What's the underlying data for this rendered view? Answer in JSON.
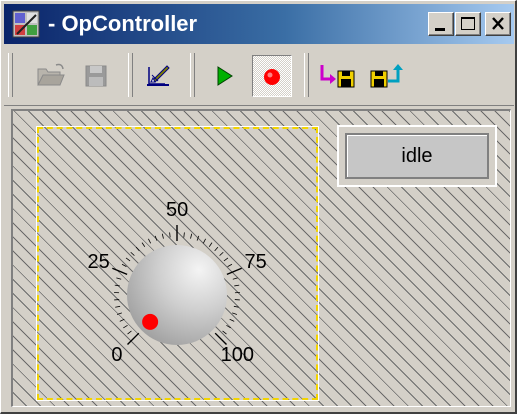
{
  "window": {
    "title": "- OpController"
  },
  "caption_buttons": [
    "minimize-icon",
    "maximize-icon",
    "close-icon"
  ],
  "toolbar": {
    "buttons": [
      {
        "name": "open",
        "icon": "folder-open-icon",
        "enabled": false
      },
      {
        "name": "save",
        "icon": "floppy-save-icon",
        "enabled": false
      },
      {
        "name": "edit",
        "icon": "edit-pencil-icon",
        "enabled": true
      },
      {
        "name": "run",
        "icon": "play-icon",
        "enabled": true,
        "color": "#00b000"
      },
      {
        "name": "record",
        "icon": "record-icon",
        "enabled": true,
        "pressed": true,
        "color": "#ff0000"
      },
      {
        "name": "import",
        "icon": "import-arrow-disk-icon",
        "enabled": true
      },
      {
        "name": "export",
        "icon": "export-disk-arrow-icon",
        "enabled": true
      }
    ]
  },
  "knob": {
    "min": 0,
    "max": 100,
    "value": 0,
    "tick_labels": [
      "0",
      "25",
      "50",
      "75",
      "100"
    ],
    "indicator_color": "#ff0000",
    "frame_color": "#f2d400"
  },
  "status": {
    "text": "idle"
  }
}
